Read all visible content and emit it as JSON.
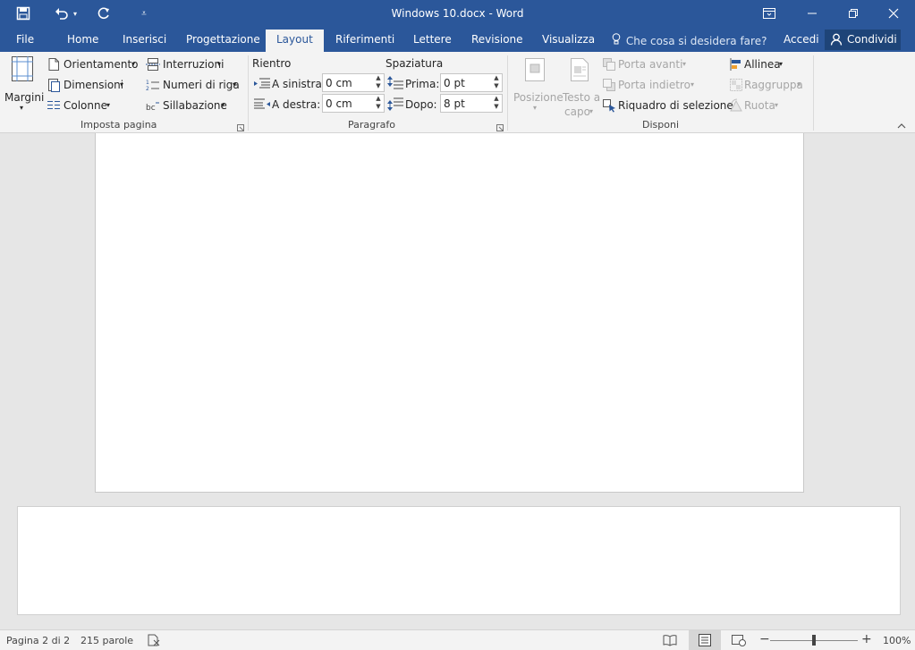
{
  "window": {
    "title": "Windows 10.docx - Word"
  },
  "quick_access": {
    "save_icon": "save-icon",
    "undo_icon": "undo-icon",
    "redo_icon": "redo-icon",
    "customize_icon": "customize-icon"
  },
  "window_controls": {
    "ribbon_display": "ribbon-display-icon",
    "minimize": "minimize-icon",
    "restore": "restore-icon",
    "close": "close-icon"
  },
  "tabs": [
    "File",
    "Home",
    "Inserisci",
    "Progettazione",
    "Layout",
    "Riferimenti",
    "Lettere",
    "Revisione",
    "Visualizza"
  ],
  "tell_me": "Che cosa si desidera fare?",
  "account": {
    "signin": "Accedi",
    "share": "Condividi"
  },
  "ribbon": {
    "page_setup": {
      "margins": "Margini",
      "orientation": "Orientamento",
      "size": "Dimensioni",
      "columns": "Colonne",
      "breaks": "Interruzioni",
      "line_numbers": "Numeri di riga",
      "hyphenation": "Sillabazione",
      "group_label": "Imposta pagina"
    },
    "paragraph": {
      "indent_heading": "Rientro",
      "left_label": "A sinistra:",
      "left_value": "0 cm",
      "right_label": "A destra:",
      "right_value": "0 cm",
      "spacing_heading": "Spaziatura",
      "before_label": "Prima:",
      "before_value": "0 pt",
      "after_label": "Dopo:",
      "after_value": "8 pt",
      "group_label": "Paragrafo"
    },
    "arrange": {
      "position": "Posizione",
      "wrap_text_1": "Testo a",
      "wrap_text_2": "capo",
      "bring_forward": "Porta avanti",
      "send_backward": "Porta indietro",
      "selection_pane": "Riquadro di selezione",
      "align": "Allinea",
      "group": "Raggruppa",
      "rotate": "Ruota",
      "group_label": "Disponi"
    }
  },
  "status": {
    "page": "Pagina 2 di 2",
    "words": "215 parole",
    "zoom": "100%",
    "zoom_level": 0.5
  }
}
